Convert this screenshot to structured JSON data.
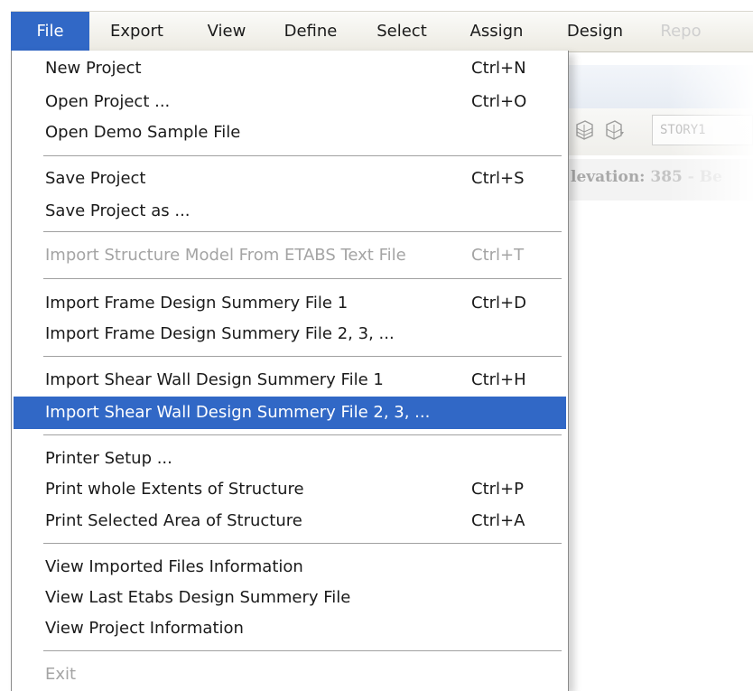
{
  "menubar": {
    "items": [
      {
        "label": "File"
      },
      {
        "label": "Export"
      },
      {
        "label": "View"
      },
      {
        "label": "Define"
      },
      {
        "label": "Select"
      },
      {
        "label": "Assign"
      },
      {
        "label": "Design"
      },
      {
        "label": "Repo"
      }
    ]
  },
  "background": {
    "story": "STORY1",
    "elevation_label": "levation:",
    "elevation_value": "385",
    "elevation_tail": "- Be"
  },
  "file_menu": {
    "items": [
      {
        "label": "New Project",
        "shortcut": "Ctrl+N"
      },
      {
        "label": "Open Project ...",
        "shortcut": "Ctrl+O"
      },
      {
        "label": "Open Demo Sample File",
        "shortcut": ""
      },
      {
        "label": "Save Project",
        "shortcut": "Ctrl+S"
      },
      {
        "label": "Save Project as ...",
        "shortcut": ""
      },
      {
        "label": "Import Structure Model From ETABS Text File",
        "shortcut": "Ctrl+T"
      },
      {
        "label": "Import Frame Design Summery File 1",
        "shortcut": "Ctrl+D"
      },
      {
        "label": "Import Frame Design Summery File 2, 3, ...",
        "shortcut": ""
      },
      {
        "label": "Import Shear Wall Design Summery File 1",
        "shortcut": "Ctrl+H"
      },
      {
        "label": "Import Shear Wall Design Summery File 2, 3, ...",
        "shortcut": ""
      },
      {
        "label": "Printer Setup ...",
        "shortcut": ""
      },
      {
        "label": "Print whole Extents of Structure",
        "shortcut": "Ctrl+P"
      },
      {
        "label": "Print Selected Area of Structure",
        "shortcut": "Ctrl+A"
      },
      {
        "label": "View Imported Files Information",
        "shortcut": ""
      },
      {
        "label": "View Last Etabs Design Summery File",
        "shortcut": ""
      },
      {
        "label": "View Project Information",
        "shortcut": ""
      },
      {
        "label": "Exit",
        "shortcut": ""
      }
    ]
  },
  "colors": {
    "highlight": "#3168c6",
    "disabled_text": "#a4a4a4"
  }
}
